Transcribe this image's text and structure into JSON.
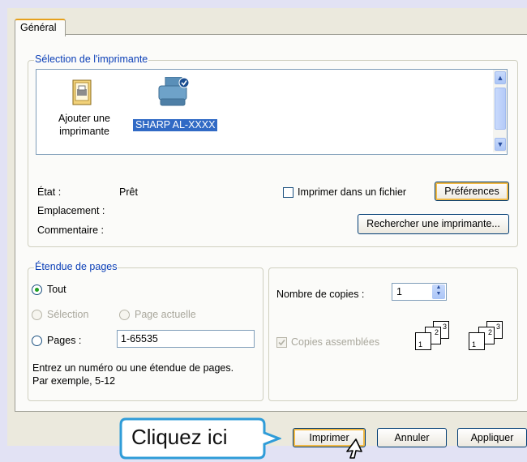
{
  "tabs": [
    {
      "label": "Général"
    }
  ],
  "printer_selection": {
    "legend": "Sélection de l'imprimante",
    "items": [
      {
        "label": "Ajouter une imprimante",
        "line1": "Ajouter une",
        "line2": "imprimante",
        "icon": "add-printer-icon"
      },
      {
        "label": "SHARP AL-XXXX",
        "icon": "printer-icon",
        "selected": true
      }
    ]
  },
  "status": {
    "etat_label": "État :",
    "etat_value": "Prêt",
    "emplacement_label": "Emplacement :",
    "commentaire_label": "Commentaire :"
  },
  "print_to_file": {
    "label": "Imprimer dans un fichier",
    "underline_char": "f",
    "checked": false
  },
  "preferences_button": "Préférences",
  "find_printer_button": "Rechercher une imprimante...",
  "page_range": {
    "legend": "Étendue de pages",
    "all": "Tout",
    "selection": "Sélection",
    "current_page": "Page actuelle",
    "pages": "Pages :",
    "pages_value": "1-65535",
    "hint_line1": "Entrez un numéro ou une étendue de pages.",
    "hint_line2": "Par exemple, 5-12"
  },
  "copies": {
    "label": "Nombre de copies :",
    "value": "1",
    "collate": "Copies assemblées",
    "collate_checked": true
  },
  "buttons": {
    "print": "Imprimer",
    "cancel": "Annuler",
    "apply": "Appliquer"
  },
  "callout": {
    "text": "Cliquez ici",
    "color": "#2f9cd8"
  },
  "colors": {
    "selection": "#316ac5",
    "legend": "#0b3fb7",
    "focus": "#f1b945",
    "radio_dot": "#21a121"
  }
}
